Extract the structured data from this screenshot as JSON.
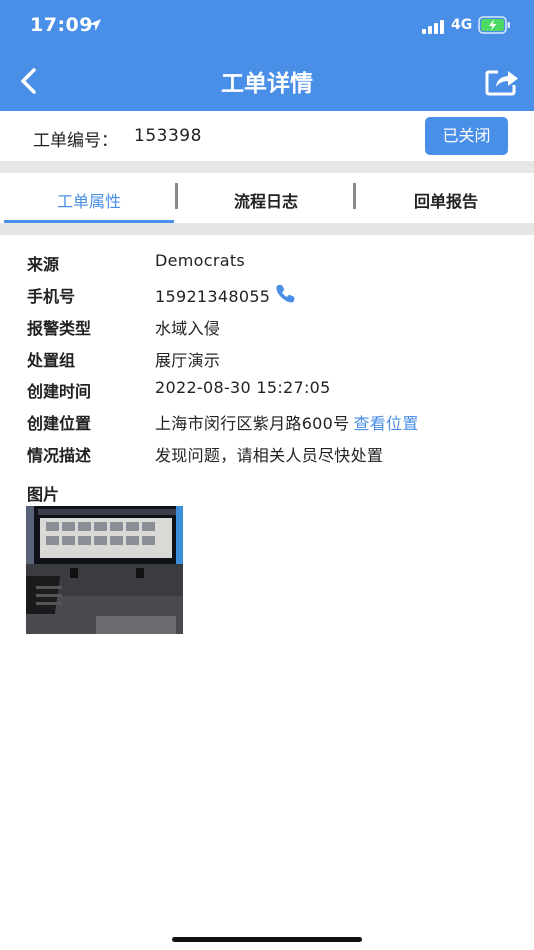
{
  "status_bar": {
    "time": "17:09",
    "network": "4G"
  },
  "nav": {
    "title": "工单详情",
    "back_icon": "chevron-left-icon",
    "share_icon": "share-icon"
  },
  "order": {
    "label": "工单编号：",
    "number": "153398",
    "status": "已关闭"
  },
  "tabs": [
    {
      "label": "工单属性",
      "active": true
    },
    {
      "label": "流程日志",
      "active": false
    },
    {
      "label": "回单报告",
      "active": false
    }
  ],
  "details": {
    "source": {
      "label": "来源",
      "value": "Democrats"
    },
    "phone": {
      "label": "手机号",
      "value": "15921348055"
    },
    "alarm_type": {
      "label": "报警类型",
      "value": "水域入侵"
    },
    "handler_group": {
      "label": "处置组",
      "value": "展厅演示"
    },
    "created_time": {
      "label": "创建时间",
      "value": "2022-08-30 15:27:05"
    },
    "created_location": {
      "label": "创建位置",
      "value": "上海市闵行区紫月路600号",
      "link": "查看位置"
    },
    "description": {
      "label": "情况描述",
      "value": "发现问题，请相关人员尽快处置"
    }
  },
  "pictures": {
    "label": "图片"
  },
  "colors": {
    "primary": "#4a8fe7",
    "divider": "#e6e6e6"
  }
}
